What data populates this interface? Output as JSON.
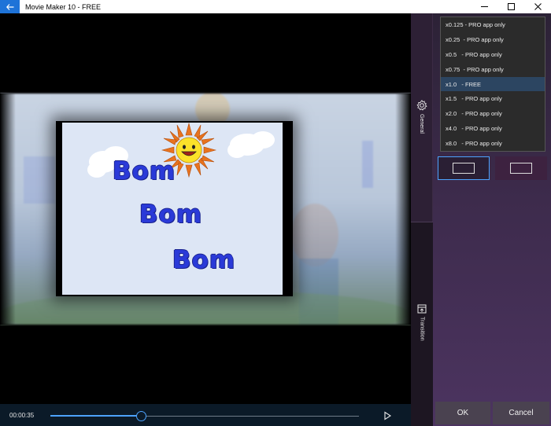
{
  "window": {
    "title": "Movie Maker 10 - FREE"
  },
  "player": {
    "current_time": "00:00:35",
    "progress_fraction": 0.295
  },
  "slide": {
    "line1": "Bom",
    "line2": "Bom",
    "line3": "Bom"
  },
  "side_tabs": {
    "general": "General",
    "transition": "Transition"
  },
  "speed_dropdown": {
    "options": [
      {
        "label": "x0.125 - PRO app only",
        "selected": false
      },
      {
        "label": "x0.25  - PRO app only",
        "selected": false
      },
      {
        "label": "x0.5   - PRO app only",
        "selected": false
      },
      {
        "label": "x0.75  - PRO app only",
        "selected": false
      },
      {
        "label": "x1.0   - FREE",
        "selected": true
      },
      {
        "label": "x1.5   - PRO app only",
        "selected": false
      },
      {
        "label": "x2.0   - PRO app only",
        "selected": false
      },
      {
        "label": "x4.0   - PRO app only",
        "selected": false
      },
      {
        "label": "x8.0   - PRO app only",
        "selected": false
      }
    ]
  },
  "buttons": {
    "ok": "OK",
    "cancel": "Cancel"
  },
  "colors": {
    "accent": "#4da3ff",
    "titlebar_back": "#1e73d8",
    "selected_item": "#2c4561"
  }
}
